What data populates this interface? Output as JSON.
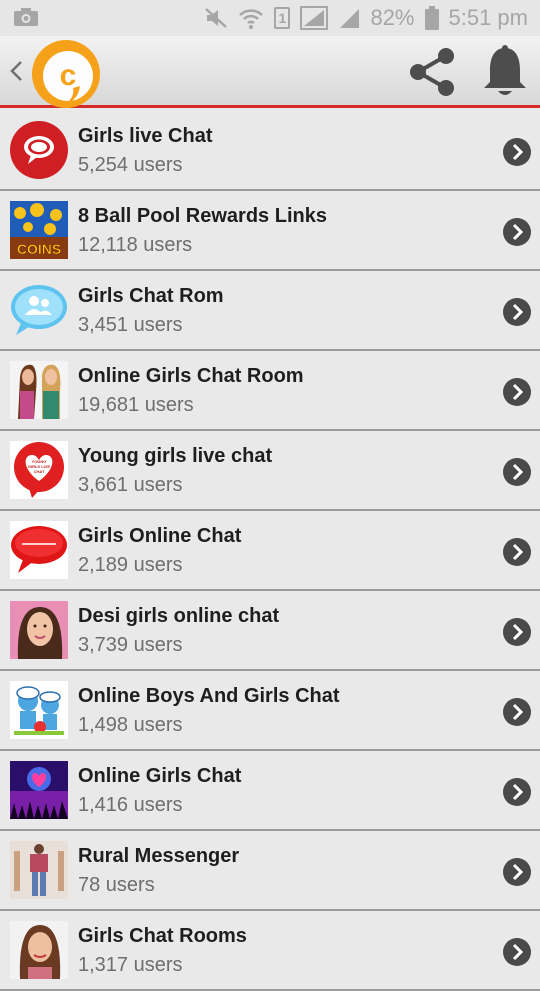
{
  "status_bar": {
    "battery_text": "82%",
    "time_text": "5:51 pm",
    "sim_label": "1",
    "icons": [
      "camera-icon",
      "mute-icon",
      "wifi-icon",
      "sim-icon",
      "signal-icon",
      "signal-icon",
      "battery-icon"
    ]
  },
  "app_bar": {
    "logo_letter": "c",
    "icons": [
      "back-arrow-icon",
      "app-logo",
      "share-icon",
      "bell-icon"
    ],
    "accent_color": "#d42a2a",
    "logo_color": "#f5a21a"
  },
  "rooms": [
    {
      "name": "Girls live Chat",
      "users": "5,254 users",
      "thumb": "red-chat-bubble-icon"
    },
    {
      "name": "8 Ball Pool Rewards Links",
      "users": "12,118 users",
      "thumb": "coins-image",
      "thumb_text": "COINS"
    },
    {
      "name": "Girls Chat Rom",
      "users": "3,451 users",
      "thumb": "blue-chat-users-icon"
    },
    {
      "name": "Online Girls Chat Room",
      "users": "19,681 users",
      "thumb": "two-girls-photo"
    },
    {
      "name": "Young girls live chat",
      "users": "3,661 users",
      "thumb": "heart-bubble-image",
      "thumb_text": "YOUNG GIRLS LIVE CHAT"
    },
    {
      "name": "Girls Online Chat",
      "users": "2,189 users",
      "thumb": "red-speech-bubble-image"
    },
    {
      "name": "Desi girls online chat",
      "users": "3,739 users",
      "thumb": "girl-portrait-photo"
    },
    {
      "name": "Online Boys And Girls Chat",
      "users": "1,498 users",
      "thumb": "cartoon-image"
    },
    {
      "name": "Online Girls Chat",
      "users": "1,416 users",
      "thumb": "concert-heart-image"
    },
    {
      "name": "Rural Messenger",
      "users": "78 users",
      "thumb": "person-standing-photo"
    },
    {
      "name": "Girls Chat Rooms",
      "users": "1,317 users",
      "thumb": "woman-portrait-photo"
    }
  ]
}
